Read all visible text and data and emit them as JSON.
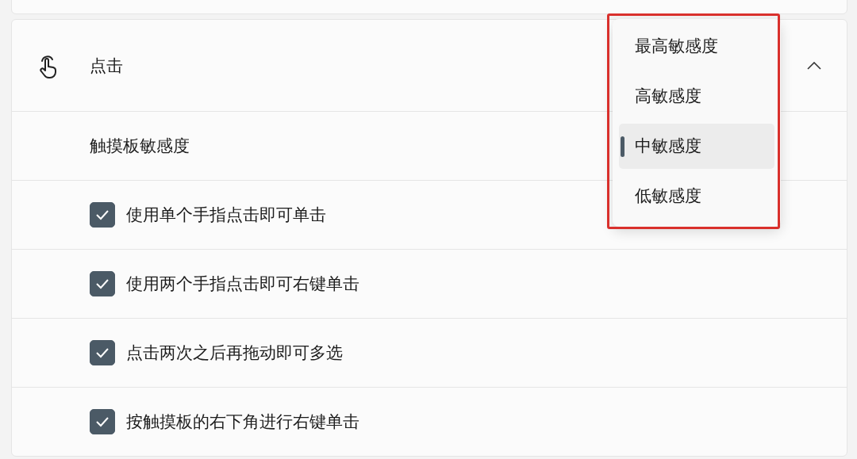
{
  "section": {
    "title": "点击",
    "expanded": true
  },
  "sensitivity": {
    "label": "触摸板敏感度",
    "options": [
      {
        "label": "最高敏感度",
        "selected": false
      },
      {
        "label": "高敏感度",
        "selected": false
      },
      {
        "label": "中敏感度",
        "selected": true
      },
      {
        "label": "低敏感度",
        "selected": false
      }
    ]
  },
  "options": [
    {
      "label": "使用单个手指点击即可单击",
      "checked": true
    },
    {
      "label": "使用两个手指点击即可右键单击",
      "checked": true
    },
    {
      "label": "点击两次之后再拖动即可多选",
      "checked": true
    },
    {
      "label": "按触摸板的右下角进行右键单击",
      "checked": true
    }
  ]
}
